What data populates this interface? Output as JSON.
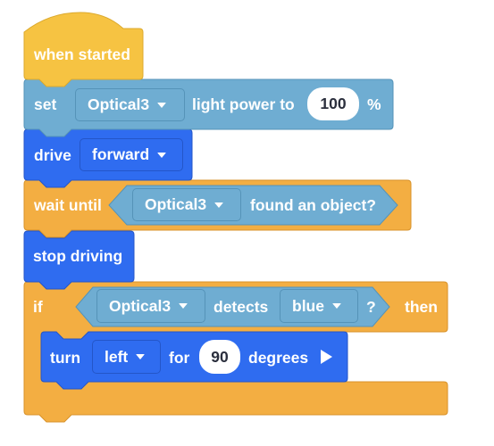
{
  "colors": {
    "events": "#f6c342",
    "sensing": "#6fadd2",
    "drivetrain": "#2f6cf0",
    "control": "#f3ae42"
  },
  "blocks": {
    "when_started": {
      "label": "when started"
    },
    "set_light": {
      "prefix": "set",
      "sensor": "Optical3",
      "middle": "light power to",
      "value": "100",
      "suffix": "%"
    },
    "drive": {
      "prefix": "drive",
      "direction": "forward"
    },
    "wait_until": {
      "prefix": "wait until",
      "sensor": "Optical3",
      "condition": "found an object?"
    },
    "stop_driving": {
      "label": "stop driving"
    },
    "if_block": {
      "prefix": "if",
      "sensor": "Optical3",
      "middle": "detects",
      "color": "blue",
      "question": "?",
      "suffix": "then"
    },
    "turn": {
      "prefix": "turn",
      "direction": "left",
      "middle": "for",
      "value": "90",
      "suffix": "degrees",
      "icon": "play-icon"
    }
  }
}
